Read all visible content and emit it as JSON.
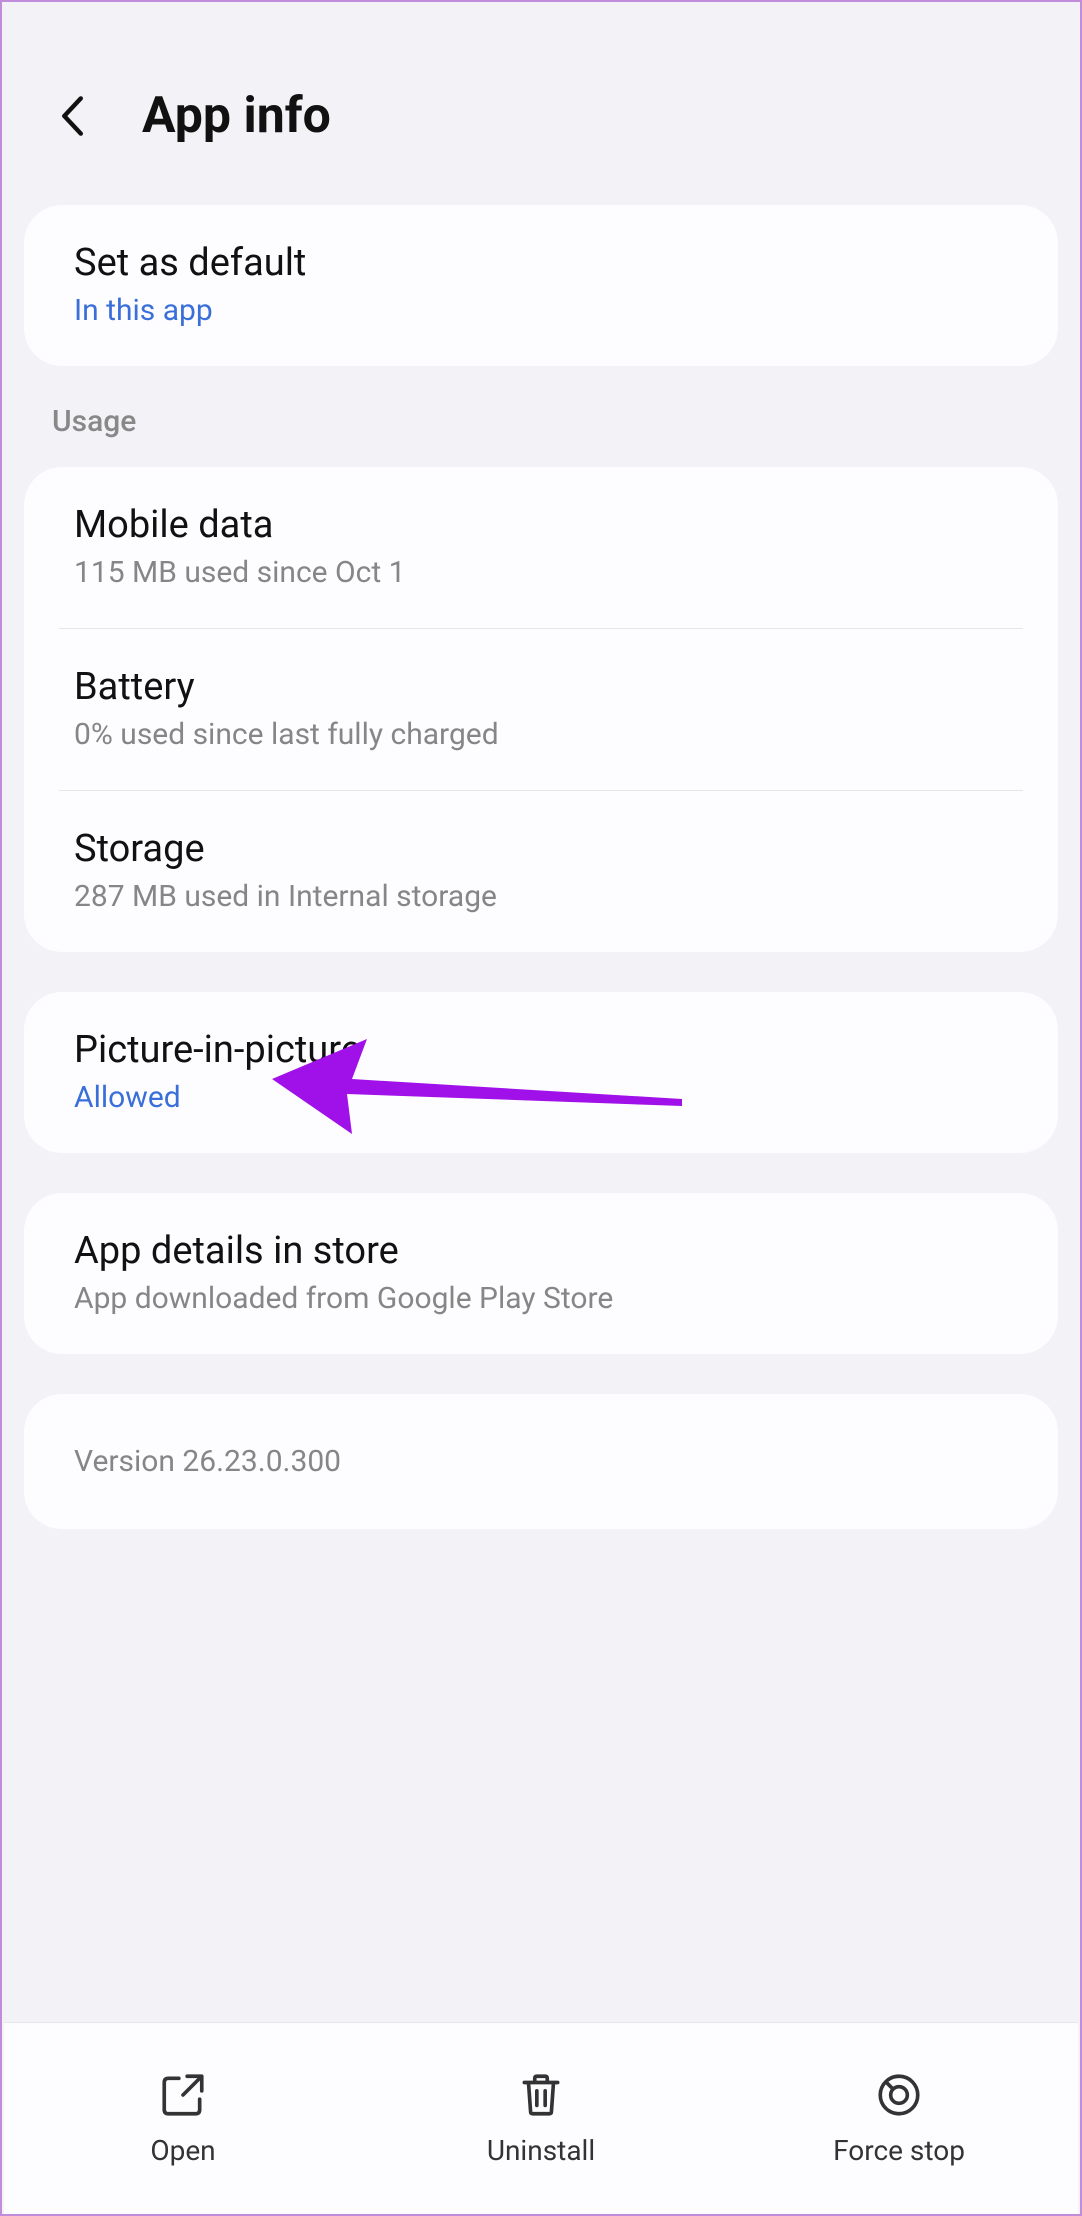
{
  "header": {
    "title": "App info"
  },
  "set_default": {
    "title": "Set as default",
    "subtitle": "In this app"
  },
  "usage": {
    "header": "Usage",
    "mobile_data": {
      "title": "Mobile data",
      "subtitle": "115 MB used since Oct 1"
    },
    "battery": {
      "title": "Battery",
      "subtitle": "0% used since last fully charged"
    },
    "storage": {
      "title": "Storage",
      "subtitle": "287 MB used in Internal storage"
    }
  },
  "pip": {
    "title": "Picture-in-picture",
    "subtitle": "Allowed"
  },
  "store": {
    "title": "App details in store",
    "subtitle": "App downloaded from Google Play Store"
  },
  "version": {
    "text": "Version 26.23.0.300"
  },
  "bottom": {
    "open": "Open",
    "uninstall": "Uninstall",
    "force_stop": "Force stop"
  }
}
